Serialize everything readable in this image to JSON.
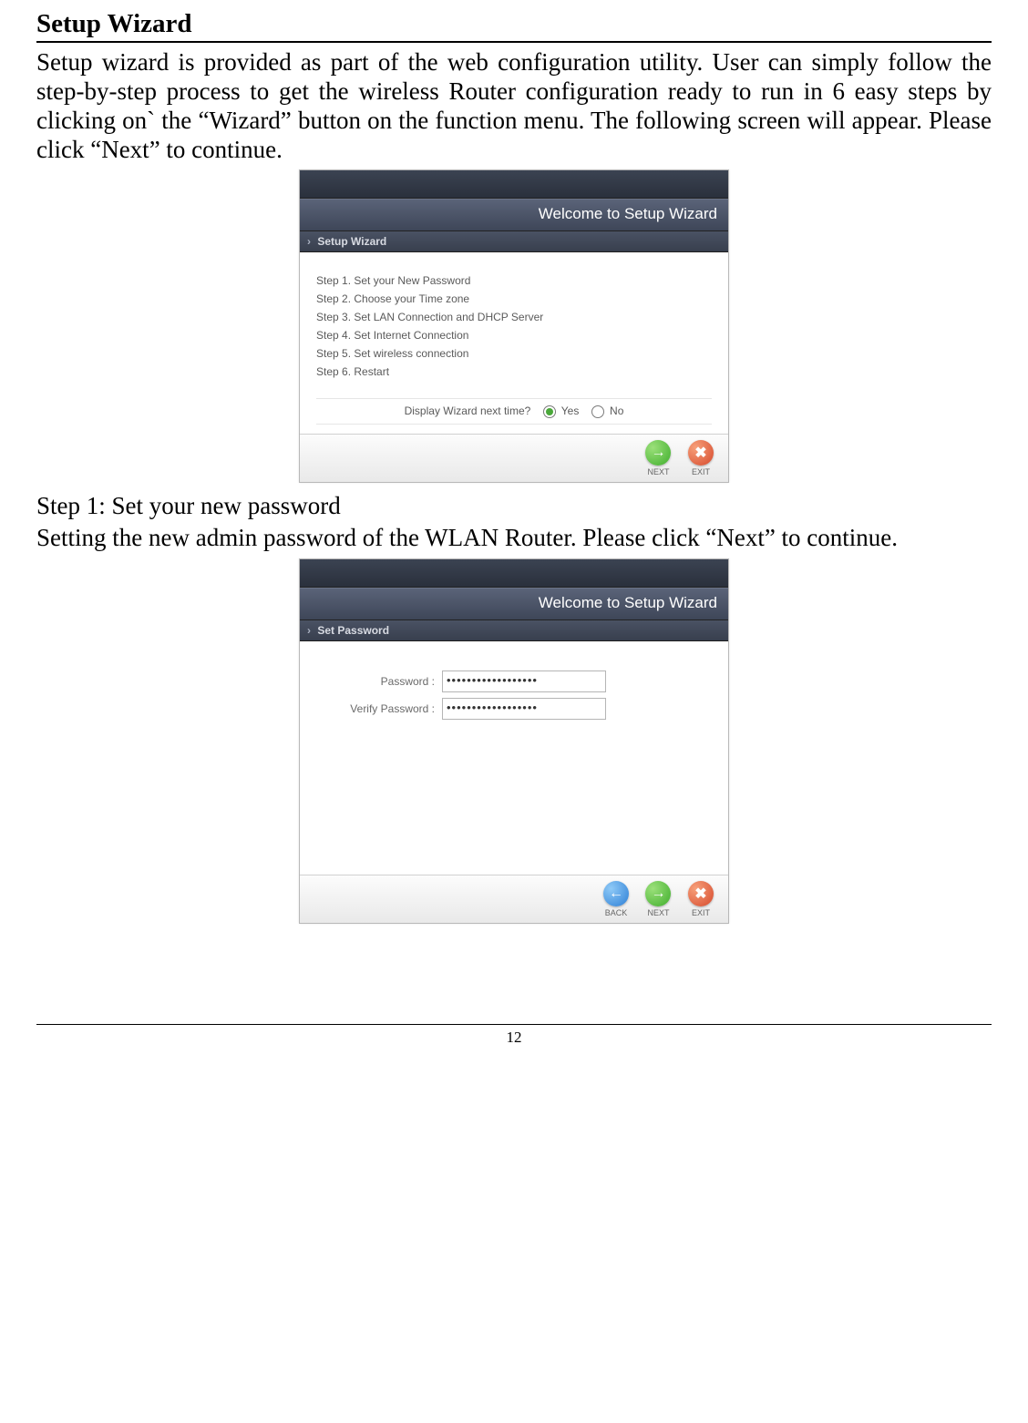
{
  "title": "Setup Wizard",
  "intro": "Setup wizard is provided as part of the web configuration utility. User can simply follow the step-by-step process to get the wireless Router configuration ready to run in 6 easy steps by clicking on` the “Wizard” button on the function menu. The following screen will appear. Please click “Next” to continue.",
  "fig1": {
    "titlebar": "Welcome to Setup Wizard",
    "crumb": "Setup Wizard",
    "steps": [
      "Step 1. Set your New Password",
      "Step 2. Choose your Time zone",
      "Step 3. Set LAN Connection and DHCP Server",
      "Step 4. Set Internet Connection",
      "Step 5. Set wireless connection",
      "Step 6. Restart"
    ],
    "display_question": "Display Wizard next time?",
    "yes": "Yes",
    "no": "No",
    "next_label": "NEXT",
    "exit_label": "EXIT"
  },
  "step1_title": "Step 1: Set your new password",
  "step1_text": "Setting the new admin password of the WLAN Router. Please click “Next” to continue.",
  "fig2": {
    "titlebar": "Welcome to Setup Wizard",
    "crumb": "Set Password",
    "password_label": "Password :",
    "verify_label": "Verify Password :",
    "password_value": "••••••••••••••••••",
    "verify_value": "••••••••••••••••••",
    "back_label": "BACK",
    "next_label": "NEXT",
    "exit_label": "EXIT"
  },
  "page_number": "12"
}
